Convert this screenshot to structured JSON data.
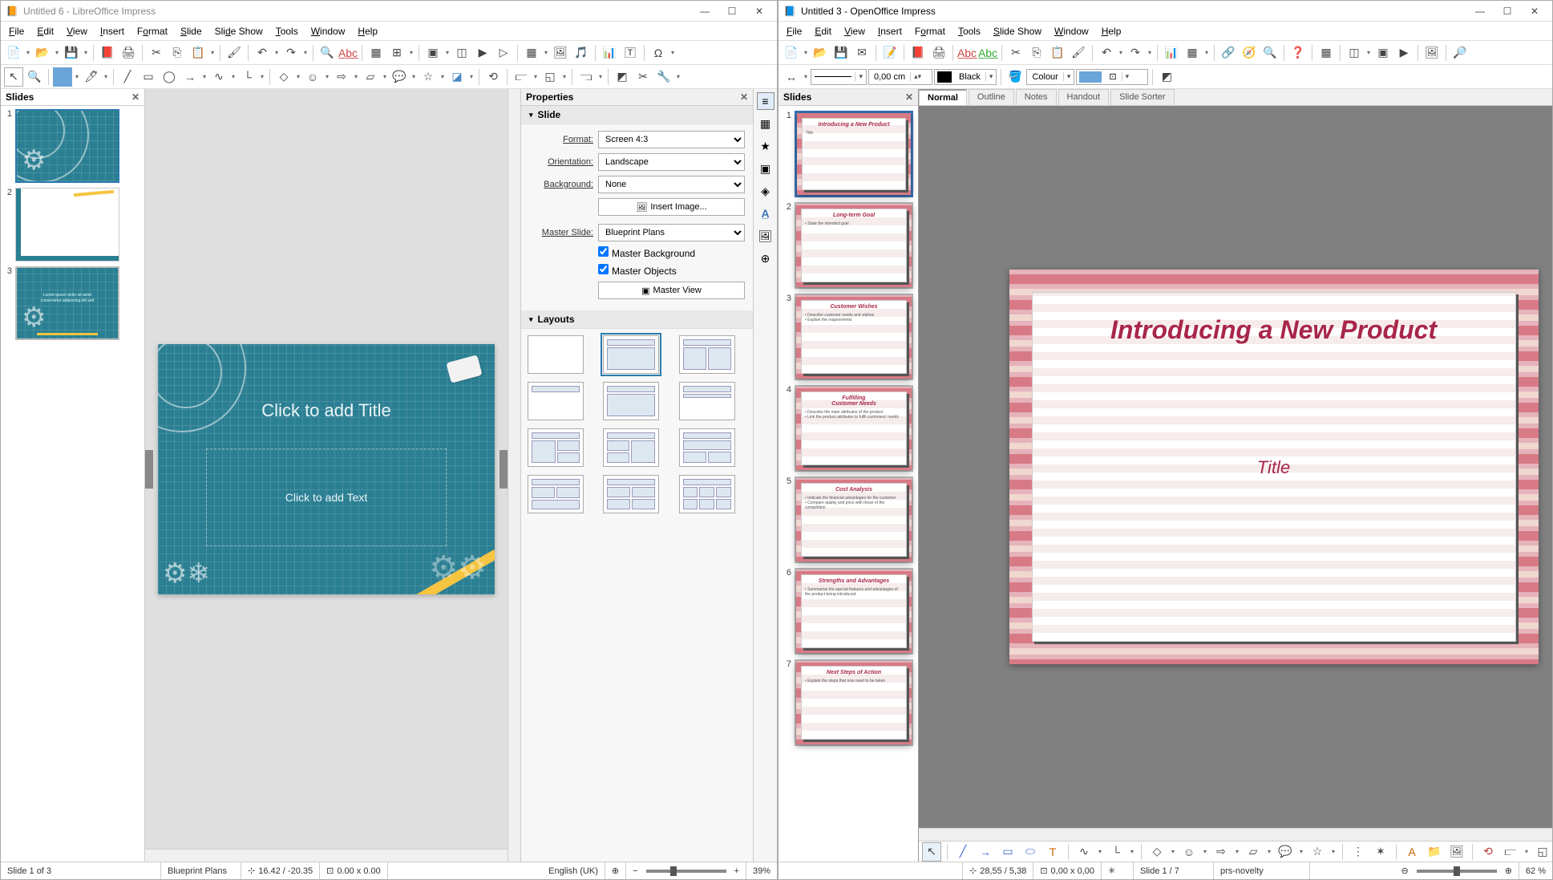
{
  "libre": {
    "title": "Untitled 6 - LibreOffice Impress",
    "menu": [
      "File",
      "Edit",
      "View",
      "Insert",
      "Format",
      "Slide",
      "Slide Show",
      "Tools",
      "Window",
      "Help"
    ],
    "slides_panel_title": "Slides",
    "slide_count": 3,
    "thumbs": [
      {
        "num": 1,
        "kind": "blueprint-title"
      },
      {
        "num": 2,
        "kind": "blueprint-blank"
      },
      {
        "num": 3,
        "kind": "blueprint-text"
      }
    ],
    "canvas": {
      "title_placeholder": "Click to add Title",
      "text_placeholder": "Click to add Text"
    },
    "props": {
      "panel_title": "Properties",
      "slide_section": "Slide",
      "format_label": "Format:",
      "format_value": "Screen 4:3",
      "orientation_label": "Orientation:",
      "orientation_value": "Landscape",
      "background_label": "Background:",
      "background_value": "None",
      "insert_image_btn": "Insert Image...",
      "master_slide_label": "Master Slide:",
      "master_slide_value": "Blueprint Plans",
      "master_bg_chk": "Master Background",
      "master_obj_chk": "Master Objects",
      "master_view_btn": "Master View",
      "layouts_section": "Layouts"
    },
    "status": {
      "slide_of": "Slide 1 of 3",
      "master": "Blueprint Plans",
      "pos": "16.42 / -20.35",
      "size": "0.00 x 0.00",
      "lang": "English (UK)",
      "zoom": "39%"
    }
  },
  "oo": {
    "title": "Untitled 3 - OpenOffice Impress",
    "menu": [
      "File",
      "Edit",
      "View",
      "Insert",
      "Format",
      "Tools",
      "Slide Show",
      "Window",
      "Help"
    ],
    "toolbar2": {
      "width": "0,00 cm",
      "line_color": "Black",
      "fill_mode": "Colour",
      "fill_swatch": "#6aa4d9"
    },
    "slides_panel_title": "Slides",
    "tabs": [
      "Normal",
      "Outline",
      "Notes",
      "Handout",
      "Slide Sorter"
    ],
    "active_tab": "Normal",
    "slides": [
      {
        "num": 1,
        "title": "Introducing a New Product",
        "body": "Title"
      },
      {
        "num": 2,
        "title": "Long-term Goal",
        "body": "• State the intended goal"
      },
      {
        "num": 3,
        "title": "Customer Wishes",
        "body": "• Describe customer needs and wishes\n• Explain the requirements"
      },
      {
        "num": 4,
        "title": "Fulfilling\nCustomer Needs",
        "body": "• Describe the main attributes of the product\n• Link the product attributes to fulfil customers' needs"
      },
      {
        "num": 5,
        "title": "Cost Analysis",
        "body": "• Indicate the financial advantages for the customer\n• Compare quality and price with those of the competition"
      },
      {
        "num": 6,
        "title": "Strengths and Advantages",
        "body": "• Summarise the special features and advantages of the product being introduced"
      },
      {
        "num": 7,
        "title": "Next Steps of Action",
        "body": "• Explain the steps that now need to be taken"
      }
    ],
    "main_slide": {
      "title": "Introducing a New Product",
      "sub": "Title"
    },
    "status": {
      "pos": "28,55 / 5,38",
      "size": "0,00 x 0,00",
      "slide_of": "Slide 1 / 7",
      "master": "prs-novelty",
      "zoom": "62 %"
    }
  }
}
